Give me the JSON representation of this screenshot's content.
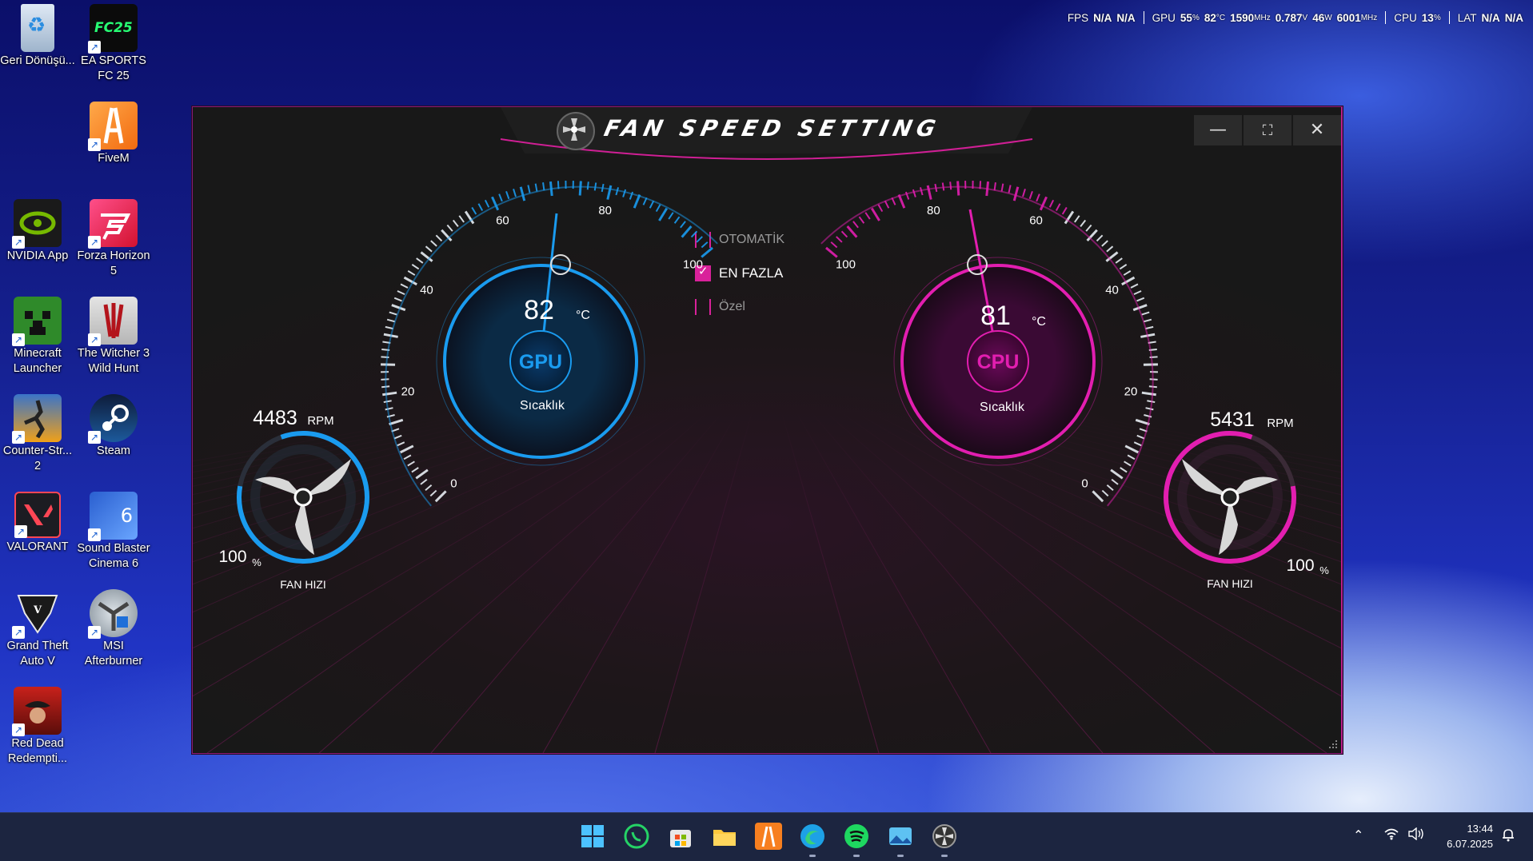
{
  "overlay": {
    "fps_label": "FPS",
    "fps_v1": "N/A",
    "fps_v2": "N/A",
    "gpu_label": "GPU",
    "gpu_util": "55",
    "gpu_util_u": "%",
    "gpu_temp": "82",
    "gpu_temp_u": "°C",
    "gpu_clock": "1590",
    "gpu_clock_u": "MHz",
    "gpu_volt": "0.787",
    "gpu_volt_u": "V",
    "gpu_power": "46",
    "gpu_power_u": "W",
    "gpu_mem": "6001",
    "gpu_mem_u": "MHz",
    "cpu_label": "CPU",
    "cpu_util": "13",
    "cpu_util_u": "%",
    "lat_label": "LAT",
    "lat_v1": "N/A",
    "lat_v2": "N/A"
  },
  "desktop": {
    "icons": [
      {
        "name": "Geri Dönüşü...",
        "icon": "recycle-bin-icon"
      },
      {
        "name": "EA SPORTS FC 25",
        "icon": "fc25-icon",
        "text": "FC25"
      },
      {
        "name": "FiveM",
        "icon": "fivem-icon"
      },
      {
        "name": "NVIDIA App",
        "icon": "nvidia-icon"
      },
      {
        "name": "Forza Horizon 5",
        "icon": "forza-icon"
      },
      {
        "name": "Minecraft Launcher",
        "icon": "minecraft-icon"
      },
      {
        "name": "The Witcher 3 Wild Hunt",
        "icon": "witcher-icon"
      },
      {
        "name": "Counter-Str... 2",
        "icon": "counter-strike-icon"
      },
      {
        "name": "Steam",
        "icon": "steam-icon"
      },
      {
        "name": "VALORANT",
        "icon": "valorant-icon"
      },
      {
        "name": "Sound Blaster Cinema 6",
        "icon": "sound-blaster-icon"
      },
      {
        "name": "Grand Theft Auto V",
        "icon": "gta-icon"
      },
      {
        "name": "MSI Afterburner",
        "icon": "msi-afterburner-icon"
      },
      {
        "name": "Red Dead Redempti...",
        "icon": "red-dead-icon"
      }
    ]
  },
  "app": {
    "title": "FAN SPEED SETTING",
    "modes": [
      {
        "label": "OTOMATİK",
        "checked": false
      },
      {
        "label": "EN FAZLA",
        "checked": true
      },
      {
        "label": "Özel",
        "checked": false
      }
    ],
    "gpu": {
      "label": "GPU",
      "temp": "82",
      "temp_unit": "°C",
      "temp_label": "Sıcaklık",
      "rpm": "4483",
      "rpm_unit": "RPM",
      "fan_pct": "100",
      "fan_pct_unit": "%",
      "fan_label": "FAN HIZI",
      "scale": [
        "0",
        "20",
        "40",
        "60",
        "80",
        "100"
      ],
      "accent": "#1a9bef",
      "fan_level": 1.0
    },
    "cpu": {
      "label": "CPU",
      "temp": "81",
      "temp_unit": "°C",
      "temp_label": "Sıcaklık",
      "rpm": "5431",
      "rpm_unit": "RPM",
      "fan_pct": "100",
      "fan_pct_unit": "%",
      "fan_label": "FAN HIZI",
      "scale": [
        "0",
        "20",
        "40",
        "60",
        "80",
        "100"
      ],
      "accent": "#e21eb0",
      "fan_level": 1.0
    }
  },
  "taskbar": {
    "apps": [
      "windows-start-icon",
      "whatsapp-icon",
      "microsoft-store-icon",
      "file-explorer-icon",
      "fivem-icon",
      "edge-icon",
      "spotify-icon",
      "photos-icon",
      "fan-speed-app-icon"
    ],
    "time": "13:44",
    "date": "6.07.2025"
  }
}
